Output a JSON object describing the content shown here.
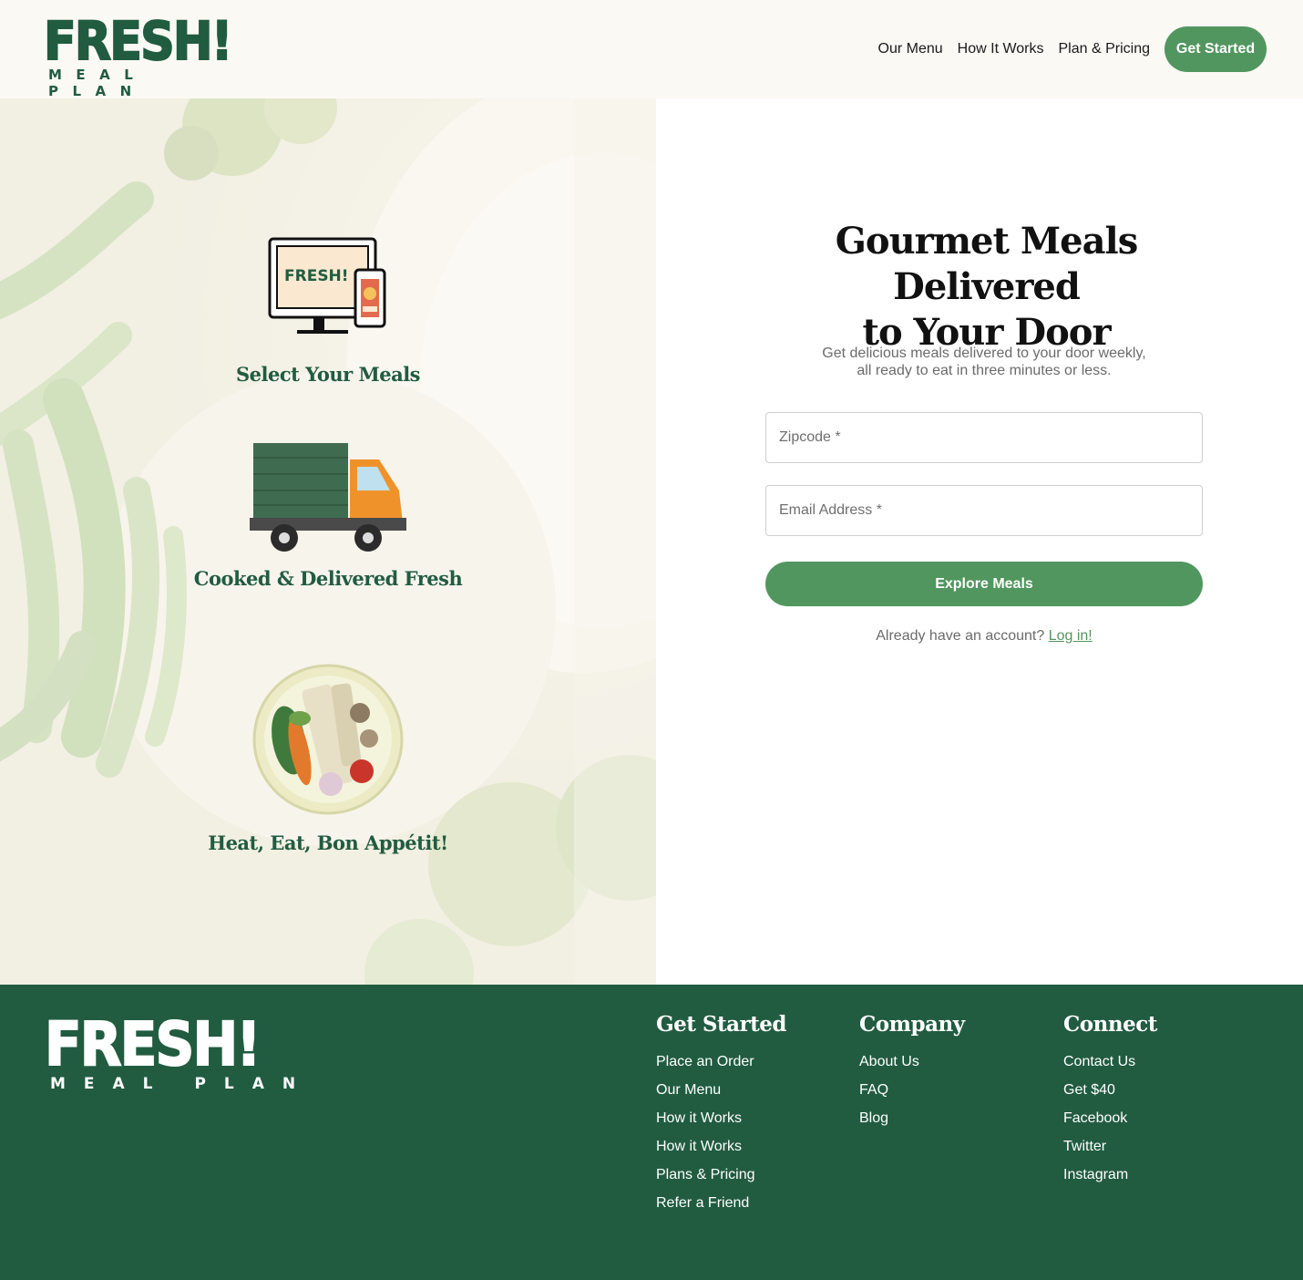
{
  "header": {
    "logo": {
      "word": "FRESH!",
      "sub": "MEAL PLAN"
    },
    "nav": [
      {
        "label": "Our Menu"
      },
      {
        "label": "How It Works"
      },
      {
        "label": "Plan & Pricing"
      }
    ],
    "cta": "Get Started"
  },
  "steps": [
    {
      "title": "Select Your Meals",
      "icon": "computer-phone-icon",
      "screen_text": "FRESH!"
    },
    {
      "title": "Cooked & Delivered Fresh",
      "icon": "delivery-truck-icon"
    },
    {
      "title": "Heat, Eat, Bon Appétit!",
      "icon": "meal-plate-icon"
    }
  ],
  "hero": {
    "title_line1": "Gourmet Meals Delivered",
    "title_line2": "to Your Door",
    "subtitle_line1": "Get delicious meals delivered to your door weekly,",
    "subtitle_line2": "all ready to eat in three minutes or less.",
    "zipcode_placeholder": "Zipcode *",
    "email_placeholder": "Email Address *",
    "button": "Explore Meals",
    "login_prompt": "Already have an account?",
    "login_link": "Log in!"
  },
  "footer": {
    "logo": {
      "word": "FRESH!",
      "sub": "MEAL PLAN"
    },
    "columns": [
      {
        "heading": "Get Started",
        "links": [
          "Place an Order",
          "Our Menu",
          "How it Works",
          "How it Works",
          "Plans & Pricing",
          "Refer a Friend"
        ]
      },
      {
        "heading": "Company",
        "links": [
          "About Us",
          "FAQ",
          "Blog"
        ]
      },
      {
        "heading": "Connect",
        "links": [
          "Contact Us",
          "Get $40",
          "Facebook",
          "Twitter",
          "Instagram"
        ]
      }
    ]
  },
  "colors": {
    "brand_green": "#215c40",
    "button_green": "#52965f",
    "header_bg": "#fbf9f4"
  }
}
